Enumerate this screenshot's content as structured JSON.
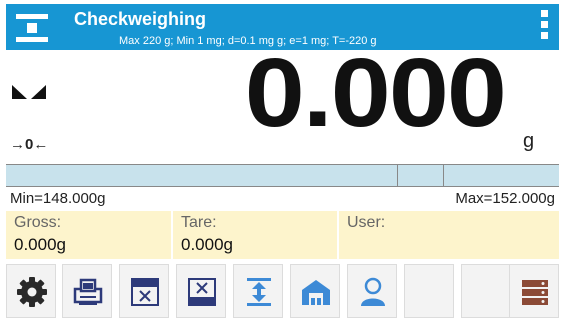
{
  "header": {
    "title": "Checkweighing",
    "subtitle": "Max 220 g; Min 1 mg; d=0.1 mg g; e=1 mg; T=-220 g",
    "icon": "checkweighing-mode-icon",
    "menu_icon": "kebab-menu-icon"
  },
  "display": {
    "weight": "0.000",
    "unit": "g",
    "stable_icon": "stable-indicator-icon",
    "zero_icon": "→0←"
  },
  "limits": {
    "min": "Min=148.000g",
    "max": "Max=152.000g"
  },
  "info": {
    "gross_label": "Gross:",
    "gross_value": "0.000g",
    "tare_label": "Tare:",
    "tare_value": "0.000g",
    "user_label": "User:",
    "user_value": ""
  },
  "toolbar": [
    {
      "name": "settings-button",
      "icon": "gear-icon"
    },
    {
      "name": "printer-button",
      "icon": "printer-icon"
    },
    {
      "name": "set-limits-button",
      "icon": "limits-icon"
    },
    {
      "name": "set-limits-2-button",
      "icon": "limits-icon"
    },
    {
      "name": "tare-button",
      "icon": "tare-arrows-icon"
    },
    {
      "name": "warehouse-button",
      "icon": "warehouse-icon"
    },
    {
      "name": "user-button",
      "icon": "user-icon"
    },
    {
      "name": "empty-button-1",
      "icon": ""
    },
    {
      "name": "empty-button-2",
      "icon": ""
    },
    {
      "name": "database-button",
      "icon": "database-icon"
    }
  ],
  "colors": {
    "header": "#1796d3",
    "info_bg": "#fdf4cc",
    "bar_bg": "#c8e2ec",
    "icon_dark": "#2a2a2a",
    "icon_navy": "#2d3a7a",
    "icon_blue": "#3d8ad6",
    "icon_brown": "#8b4a36"
  }
}
